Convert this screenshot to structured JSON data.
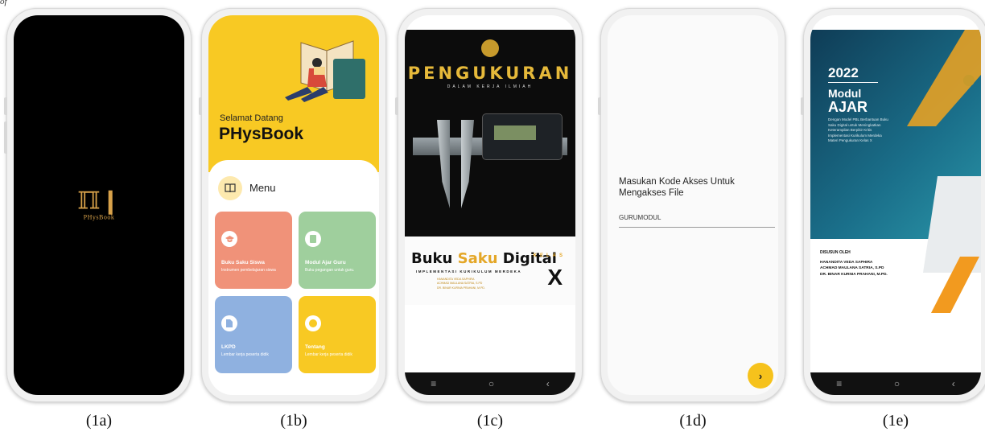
{
  "corner_text": "of",
  "captions": [
    "(1a)",
    "(1b)",
    "(1c)",
    "(1d)",
    "(1e)"
  ],
  "splash": {
    "logo_mark": "ℿ❙",
    "brand": "PHysBook"
  },
  "home": {
    "welcome": "Selamat Datang",
    "app_name": "PHysBook",
    "menu_label": "Menu",
    "cards": [
      {
        "title": "Buku Saku Siswa",
        "subtitle": "Instrumen pembelajaran siswa",
        "color": "#f09279"
      },
      {
        "title": "Modul Ajar Guru",
        "subtitle": "Buku pegangan untuk guru.",
        "color": "#9fcf9d"
      },
      {
        "title": "LKPD",
        "subtitle": "Lembar kerja peserta didik",
        "color": "#8fb1e0"
      },
      {
        "title": "Tentang",
        "subtitle": "Lembar kerja peserta didik",
        "color": "#f8c923"
      }
    ]
  },
  "cover": {
    "title": "PENGUKURAN",
    "subtitle": "DALAM KERJA ILMIAH",
    "book_a": "Buku",
    "book_b": "Saku",
    "book_c": "Digital",
    "implementasi": "IMPLEMENTASI KURIKULUM MERDEKA",
    "authors": "HANANDITA VEDA SAPHIRA\nACHMAD MAULANA SATRIA, S.PD\nDR. BINAR KURNIA PRAHANI, M.PD.",
    "kelas": "KELAS",
    "kelas_value": "X"
  },
  "access": {
    "prompt": "Masukan Kode Akses Untuk Mengakses File",
    "code_value": "GURUMODUL",
    "next_glyph": "›"
  },
  "module": {
    "year": "2022",
    "modul": "Modul",
    "ajar": "AJAR",
    "description": "Dengan Model PBL Berbantuan Buku Saku Digital untuk Meningkatkan Keterampilan Berpikir Kritis Implementasi Kurikulum Merdeka Materi Pengukuran Kelas X",
    "by_label": "DISUSUN OLEH",
    "authors": [
      "HANANDITA VEDA SAPHIRA",
      "ACHMAD MAULANA SATRIA, S.PD",
      "DR. BINAR KURNIA PRAHANI, M.PD."
    ]
  },
  "navbar": {
    "menu_glyph": "≡",
    "home_glyph": "○",
    "back_glyph": "‹"
  },
  "icons": {
    "menu": "book-icon",
    "card1": "graduation-cap-icon",
    "card2": "book-icon",
    "card3": "document-icon",
    "card4": "info-icon"
  }
}
